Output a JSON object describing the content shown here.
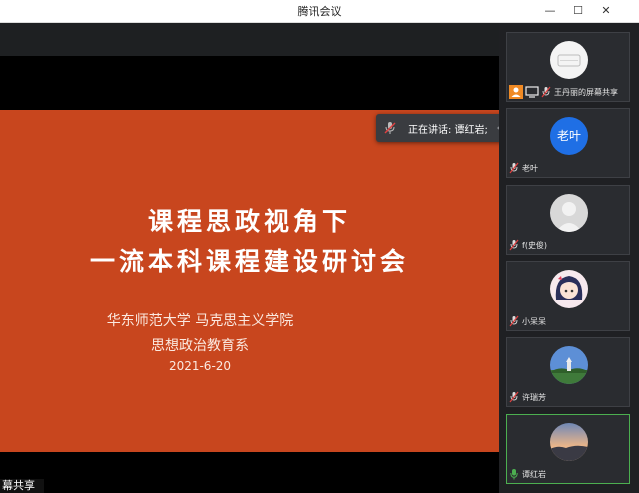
{
  "window": {
    "title": "腾讯会议",
    "minimize_glyph": "—",
    "maximize_glyph": "☐",
    "close_glyph": "✕"
  },
  "slide": {
    "title_line1": "课程思政视角下",
    "title_line2": "一流本科课程建设研讨会",
    "subtitle_line1": "华东师范大学  马克思主义学院",
    "subtitle_line2": "思想政治教育系",
    "date": "2021-6-20"
  },
  "share_tag": "幕共享",
  "speaking_toast": {
    "text": "正在讲话: 谭红岩;",
    "back_glyph": "↶"
  },
  "participants": [
    {
      "name": "王丹丽的屏幕共享",
      "avatar_icon": "screen-share-avatar",
      "mic": "muted"
    },
    {
      "name": "老叶",
      "avatar_text": "老叶",
      "mic": "muted"
    },
    {
      "name": "f(史俊)",
      "avatar_icon": "default-person-avatar",
      "mic": "muted"
    },
    {
      "name": "小呆呆",
      "avatar_icon": "anime-girl-avatar",
      "mic": "muted"
    },
    {
      "name": "许瑞芳",
      "avatar_icon": "landscape-photo-avatar",
      "mic": "muted"
    },
    {
      "name": "谭红岩",
      "avatar_icon": "sunset-photo-avatar",
      "mic": "active"
    }
  ],
  "colors": {
    "slide_bg": "#c8461e",
    "active_speaker": "#4caf50",
    "avatar_blue": "#1f6fe5"
  }
}
